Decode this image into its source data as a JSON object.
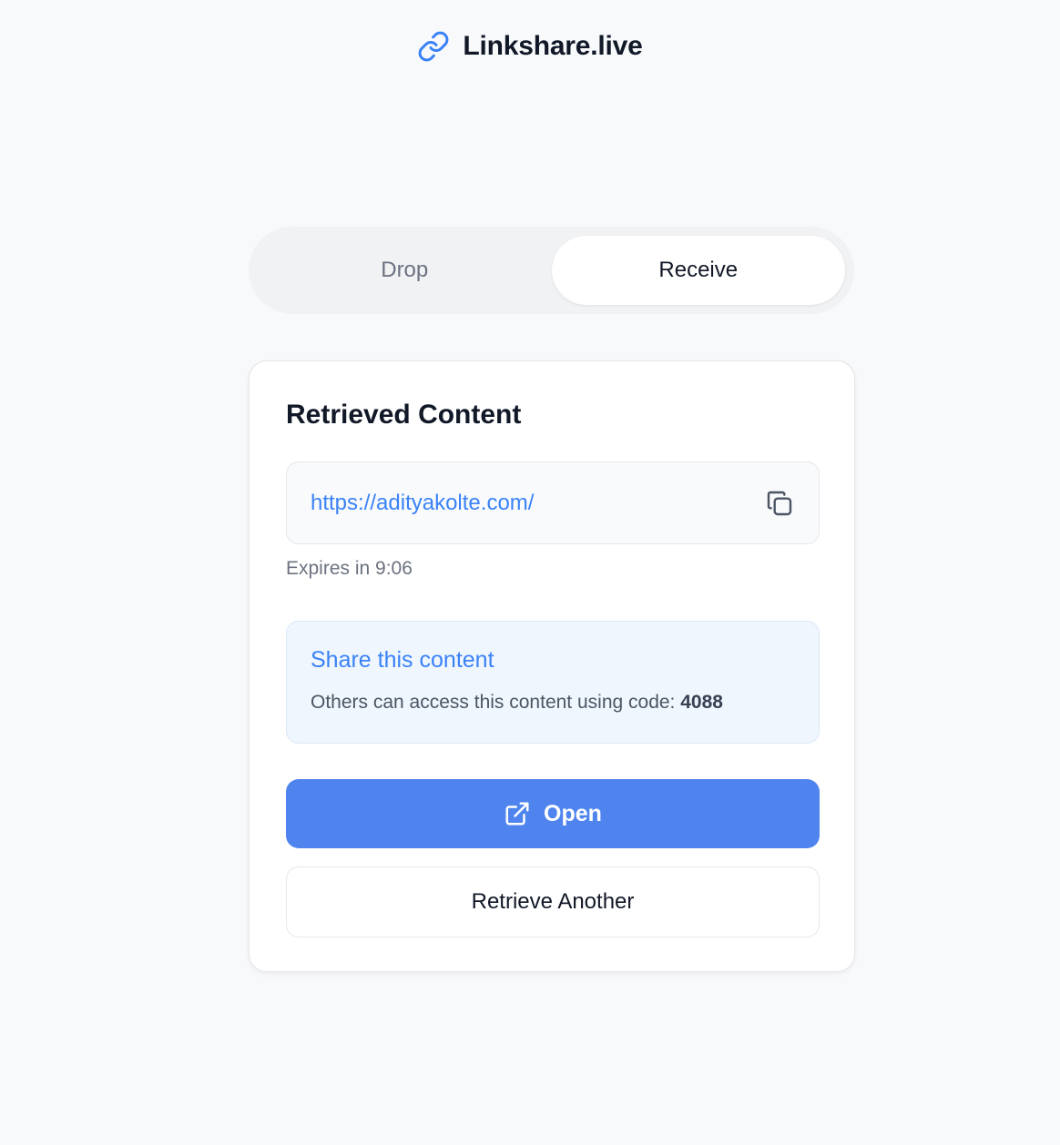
{
  "app": {
    "title": "Linkshare.live",
    "brand_icon": "link-icon",
    "accent_color": "#3b82f6",
    "button_color": "#4f84ee"
  },
  "tabs": [
    {
      "label": "Drop",
      "active": false
    },
    {
      "label": "Receive",
      "active": true
    }
  ],
  "card": {
    "title": "Retrieved Content",
    "url": "https://adityakolte.com/",
    "copy_icon": "copy-icon",
    "expires_text": "Expires in 9:06",
    "share": {
      "title": "Share this content",
      "description": "Others can access this content using code: ",
      "code": "4088"
    },
    "open_button": {
      "label": "Open",
      "icon": "external-link-icon"
    },
    "retrieve_button": {
      "label": "Retrieve Another"
    }
  }
}
